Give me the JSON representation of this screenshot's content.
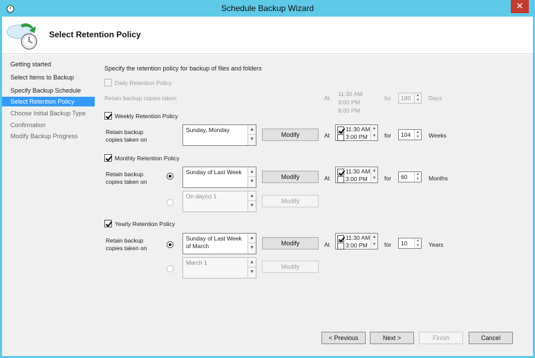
{
  "window": {
    "title": "Schedule Backup Wizard",
    "close_glyph": "✕"
  },
  "header": {
    "title": "Select Retention Policy"
  },
  "nav": {
    "items": [
      {
        "label": "Getting started",
        "state": "normal"
      },
      {
        "label": "Select Items to Backup",
        "state": "normal"
      },
      {
        "label": "Specify Backup Schedule",
        "state": "normal"
      },
      {
        "label": "Select Retention Policy",
        "state": "active"
      },
      {
        "label": "Choose Initial Backup Type",
        "state": "disabled"
      },
      {
        "label": "Confirmation",
        "state": "disabled"
      },
      {
        "label": "Modify Backup Progress",
        "state": "disabled"
      }
    ]
  },
  "main": {
    "instruction": "Specify the retention policy for backup of files and folders",
    "daily": {
      "checkbox_label": "Daily Retention Policy",
      "checked": false,
      "retain_label": "Retain backup copies taken",
      "at_label": "At",
      "times": [
        "11:30 AM",
        "3:00 PM",
        "8:00 PM"
      ],
      "for_label": "for",
      "value": "180",
      "unit": "Days"
    },
    "weekly": {
      "checkbox_label": "Weekly Retention Policy",
      "checked": true,
      "retain_label_1": "Retain backup",
      "retain_label_2": "copies taken on",
      "days": "Sunday, Monday",
      "modify_label": "Modify",
      "at_label": "At",
      "time1": "11:30 AM",
      "time2": "3:00 PM",
      "for_label": "for",
      "value": "104",
      "unit": "Weeks"
    },
    "monthly": {
      "checkbox_label": "Monthly Retention Policy",
      "checked": true,
      "retain_label_1": "Retain backup",
      "retain_label_2": "copies taken on",
      "option1": "Sunday of Last Week",
      "option2": "On day(s) 1",
      "modify_label": "Modify",
      "at_label": "At",
      "time1": "11:30 AM",
      "time2": "3:00 PM",
      "for_label": "for",
      "value": "60",
      "unit": "Months"
    },
    "yearly": {
      "checkbox_label": "Yearly Retention Policy",
      "checked": true,
      "retain_label_1": "Retain backup",
      "retain_label_2": "copies taken on",
      "option1": "Sunday of Last Week of March",
      "option2": "March 1",
      "modify_label": "Modify",
      "at_label": "At",
      "time1": "11:30 AM",
      "time2": "3:00 PM",
      "for_label": "for",
      "value": "10",
      "unit": "Years"
    }
  },
  "footer": {
    "previous": "< Previous",
    "next": "Next >",
    "finish": "Finish",
    "cancel": "Cancel"
  }
}
